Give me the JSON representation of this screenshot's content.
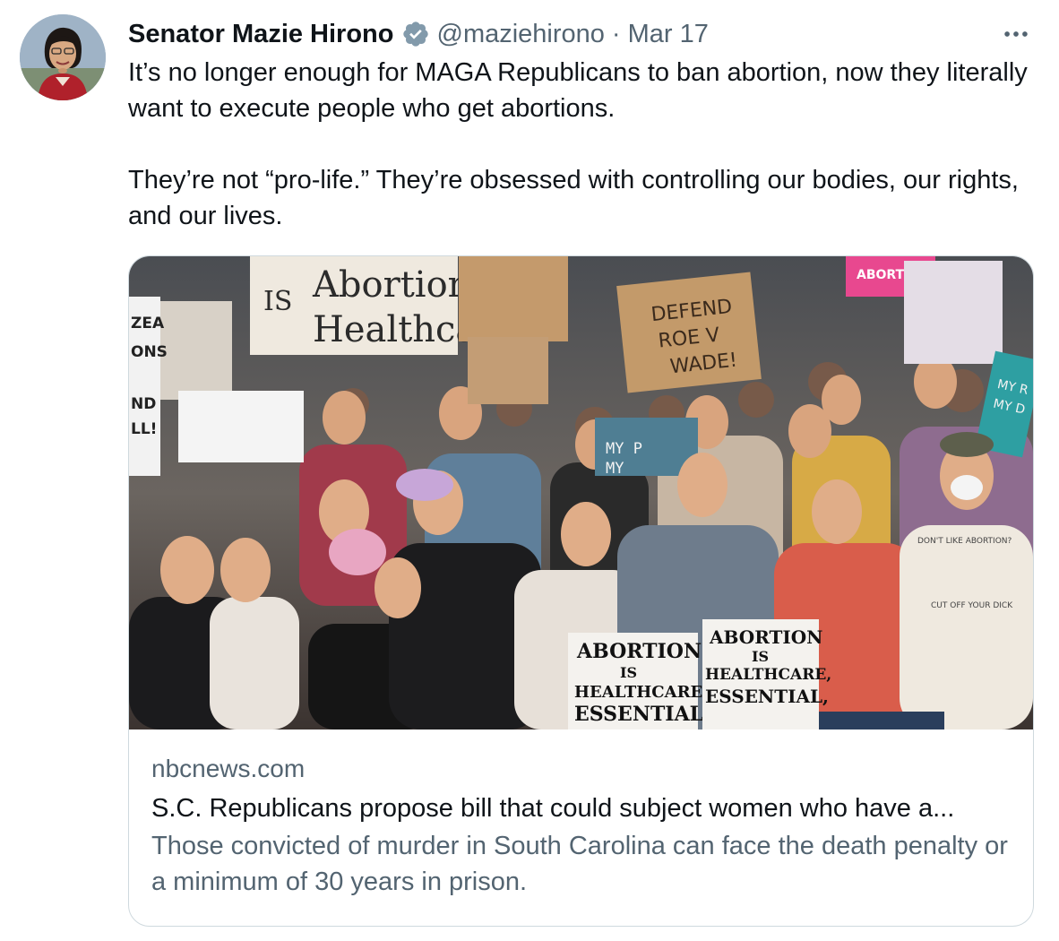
{
  "tweet": {
    "author": {
      "display_name": "Senator Mazie Hirono",
      "handle": "@maziehirono",
      "verified": true,
      "verified_color": "#829aab",
      "avatar_icon": "profile-photo"
    },
    "separator": "·",
    "date": "Mar 17",
    "more_icon": "more-horizontal-icon",
    "text": [
      "It’s no longer enough for MAGA Republicans to ban abortion, now they literally want to execute people who get abortions.",
      "They’re not “pro-life.” They’re obsessed with controlling our bodies, our rights, and our lives."
    ]
  },
  "card": {
    "image_icon": "protest-photo",
    "domain": "nbcnews.com",
    "title": "S.C. Republicans propose bill that could subject women who have a...",
    "description": "Those convicted of murder in South Carolina can face the death penalty or a minimum of 30 years in prison.",
    "signs": {
      "abortion_is_healthcare": [
        "IS",
        "Abortion",
        "Healthcare!"
      ],
      "defend_roe": [
        "DEFEND",
        "ROE V",
        "WADE!"
      ],
      "front_left": [
        "ABORTION",
        "IS",
        "HEALTHCARE,",
        "ESSENTIAL,"
      ],
      "front_right": [
        "ABORTION",
        "IS",
        "HEALTHCARE,",
        "ESSENTIAL,"
      ],
      "blue_sign": [
        "MY P",
        "MY"
      ],
      "teal_sign": [
        "MY R",
        "MY D"
      ],
      "pink_sign": "ABORTION",
      "left_edge": [
        "ZEA",
        "ONS",
        "ND",
        "LL!"
      ],
      "shirt": "DON'T LIKE ABORTION?",
      "shirt_bottom": "CUT OFF YOUR DICK"
    }
  },
  "colors": {
    "text_primary": "#0f1419",
    "text_secondary": "#536471",
    "border": "#cfd9de"
  }
}
